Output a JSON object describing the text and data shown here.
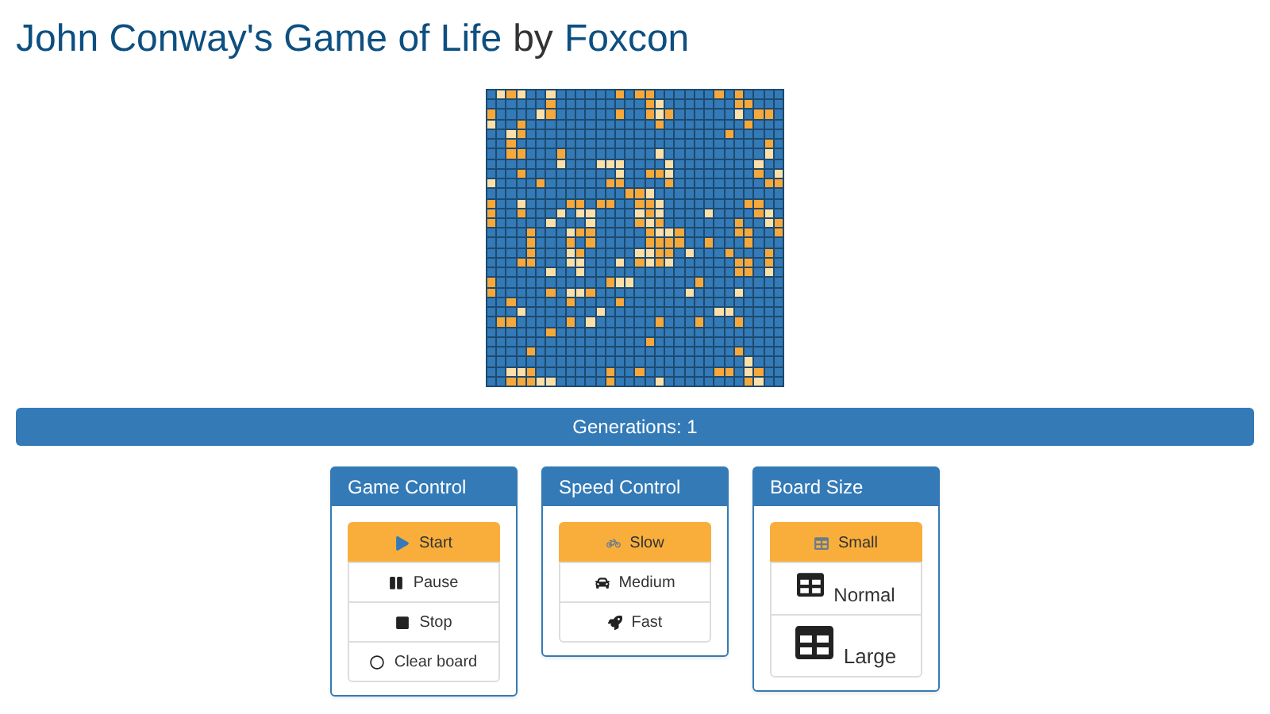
{
  "title": {
    "parts": [
      {
        "text": "John Conway's Game of Life",
        "kind": "link"
      },
      {
        "text": "by",
        "kind": "plain"
      },
      {
        "text": "Foxcon",
        "kind": "link"
      }
    ]
  },
  "status_bar": {
    "text": "Generations: 1"
  },
  "panels": [
    {
      "title": "Game Control",
      "buttons": [
        {
          "label": "Start",
          "selected": true
        },
        {
          "label": "Pause",
          "selected": false
        },
        {
          "label": "Stop",
          "selected": false
        },
        {
          "label": "Clear board",
          "selected": false
        }
      ]
    },
    {
      "title": "Speed Control",
      "buttons": [
        {
          "label": "Slow",
          "selected": true
        },
        {
          "label": "Medium",
          "selected": false
        },
        {
          "label": "Fast",
          "selected": false
        }
      ]
    },
    {
      "title": "Board Size",
      "buttons": [
        {
          "label": "Small",
          "selected": true
        },
        {
          "label": "Normal",
          "selected": false
        },
        {
          "label": "Large",
          "selected": false
        }
      ]
    }
  ]
}
